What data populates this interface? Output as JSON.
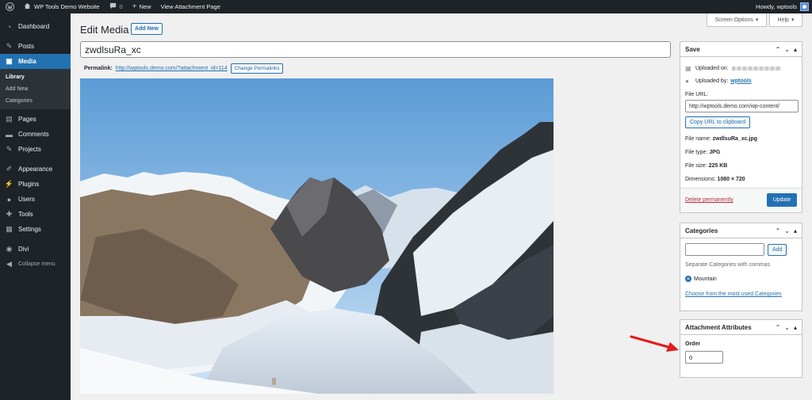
{
  "admin_bar": {
    "site_name": "WP Tools Demo Website",
    "comments_count": "0",
    "new_label": "New",
    "view_attachment": "View Attachment Page",
    "howdy": "Howdy, wptools"
  },
  "sidebar": {
    "items": [
      {
        "label": "Dashboard",
        "icon": "dashboard-icon"
      },
      {
        "label": "Posts",
        "icon": "pin-icon"
      },
      {
        "label": "Media",
        "icon": "media-icon"
      },
      {
        "label": "Pages",
        "icon": "page-icon"
      },
      {
        "label": "Comments",
        "icon": "comment-icon"
      },
      {
        "label": "Projects",
        "icon": "pin-icon"
      },
      {
        "label": "Appearance",
        "icon": "brush-icon"
      },
      {
        "label": "Plugins",
        "icon": "plug-icon"
      },
      {
        "label": "Users",
        "icon": "user-icon"
      },
      {
        "label": "Tools",
        "icon": "wrench-icon"
      },
      {
        "label": "Settings",
        "icon": "settings-icon"
      },
      {
        "label": "Divi",
        "icon": "divi-icon"
      },
      {
        "label": "Collapse menu",
        "icon": "collapse-icon"
      }
    ],
    "media_submenu": [
      "Library",
      "Add New",
      "Categories"
    ]
  },
  "screen_options": "Screen Options",
  "help": "Help",
  "page": {
    "title": "Edit Media",
    "add_new": "Add New",
    "title_value": "zwdlsuRa_xc",
    "permalink_label": "Permalink:",
    "permalink_url": "http://wptools.demo.com/?attachment_id=114",
    "change_permalinks": "Change Permalinks"
  },
  "save_box": {
    "title": "Save",
    "uploaded_on": "Uploaded on:",
    "uploaded_by": "Uploaded by:",
    "uploader": "wptools",
    "file_url_label": "File URL:",
    "file_url": "http://wptools.demo.com/wp-content/",
    "copy_url": "Copy URL to clipboard",
    "file_name_label": "File name:",
    "file_name": "zwdlsuRa_xc.jpg",
    "file_type_label": "File type:",
    "file_type": "JPG",
    "file_size_label": "File size:",
    "file_size": "225 KB",
    "dimensions_label": "Dimensions:",
    "dimensions": "1080 × 720",
    "delete": "Delete permanently",
    "update": "Update"
  },
  "categories_box": {
    "title": "Categories",
    "add": "Add",
    "howto": "Separate Categories with commas",
    "tag": "Mountain",
    "most_used": "Choose from the most used Categories"
  },
  "attributes_box": {
    "title": "Attachment Attributes",
    "order_label": "Order",
    "order_value": "0"
  },
  "colors": {
    "accent": "#2271b1",
    "admin_dark": "#1d2327",
    "arrow": "#e41b1b"
  }
}
